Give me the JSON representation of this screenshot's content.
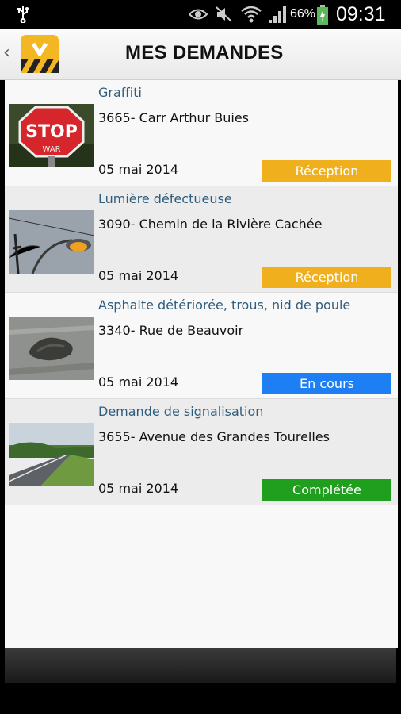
{
  "status_bar": {
    "battery": "66%",
    "time": "09:31",
    "icons": [
      "usb-icon",
      "eye-icon",
      "mute-icon",
      "wifi-icon",
      "signal-icon",
      "battery-icon"
    ]
  },
  "header": {
    "title": "MES DEMANDES",
    "back_icon": "chevron-left-icon",
    "logo_icon": "app-logo"
  },
  "colors": {
    "reception": "#F0AF1C",
    "en_cours": "#1E7FF5",
    "completee": "#1F9F1D",
    "category_text": "#2F5D7C"
  },
  "requests": [
    {
      "category": "Graffiti",
      "address": "3665- Carr Arthur Buies",
      "date": "05 mai 2014",
      "status": "Réception",
      "image": "stop-sign-graffiti-photo"
    },
    {
      "category": "Lumière défectueuse",
      "address": "3090- Chemin de la Rivière Cachée",
      "date": "05 mai 2014",
      "status": "Réception",
      "image": "street-light-photo"
    },
    {
      "category": "Asphalte détériorée, trous, nid de poule",
      "address": "3340- Rue de Beauvoir",
      "date": "05 mai 2014",
      "status": "En cours",
      "image": "pothole-photo"
    },
    {
      "category": "Demande de signalisation",
      "address": "3655- Avenue des Grandes Tourelles",
      "date": "05 mai 2014",
      "status": "Complétée",
      "image": "road-photo"
    }
  ]
}
